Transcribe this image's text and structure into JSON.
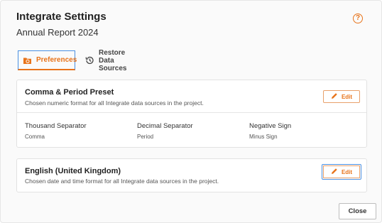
{
  "header": {
    "title": "Integrate Settings",
    "subtitle": "Annual Report 2024",
    "help_icon": "question-circle-icon"
  },
  "tabs": [
    {
      "label": "Preferences",
      "icon": "folder-gear-icon",
      "active": true
    },
    {
      "label": "Restore Data Sources",
      "icon": "history-icon",
      "active": false
    }
  ],
  "number_card": {
    "title": "Comma & Period Preset",
    "description": "Chosen numeric format for all Integrate data sources in the project.",
    "edit_label": "Edit",
    "fields": [
      {
        "label": "Thousand Separator",
        "value": "Comma"
      },
      {
        "label": "Decimal Separator",
        "value": "Period"
      },
      {
        "label": "Negative Sign",
        "value": "Minus Sign"
      }
    ]
  },
  "locale_card": {
    "title": "English (United Kingdom)",
    "description": "Chosen date and time format for all Integrate data sources in the project.",
    "edit_label": "Edit"
  },
  "footer": {
    "close_label": "Close"
  },
  "colors": {
    "accent": "#e8731a",
    "focus": "#4a90e2"
  }
}
